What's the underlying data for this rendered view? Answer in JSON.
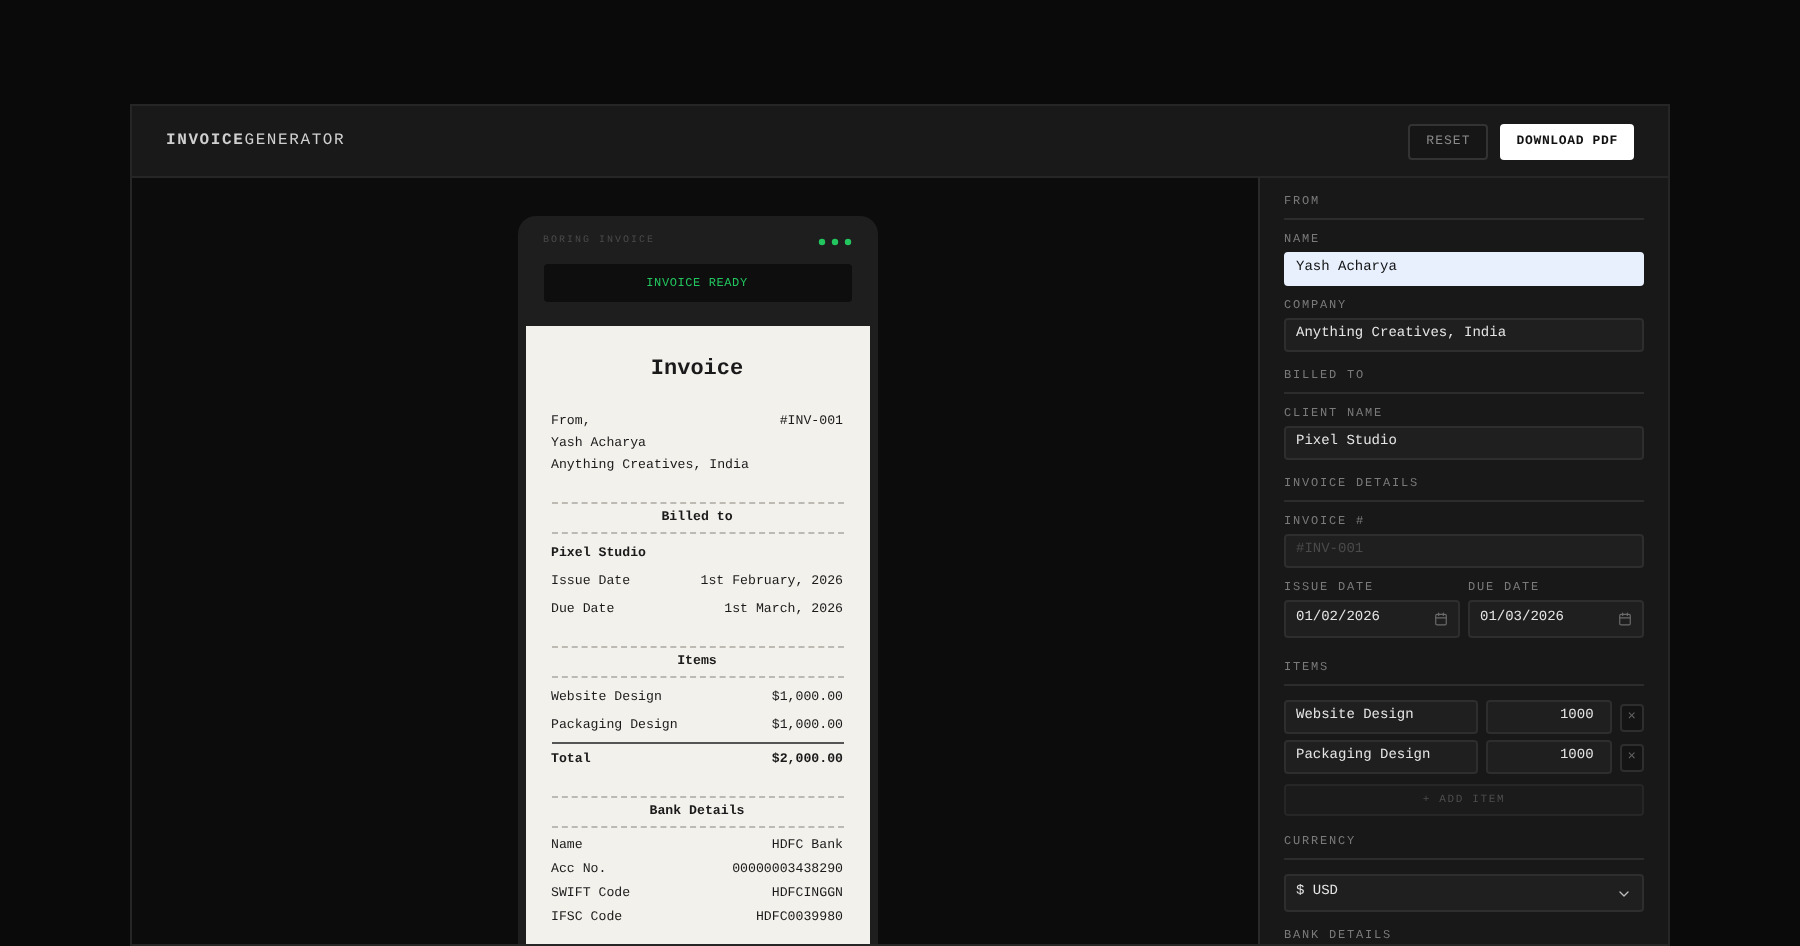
{
  "header": {
    "title": "**INVOICE**GENERATOR",
    "buttons": [
      {
        "label": "RESET",
        "kind": "secondary"
      },
      {
        "label": "DOWNLOAD PDF",
        "kind": "primary"
      }
    ]
  },
  "device": {
    "label": "BORING INVOICE",
    "status": "INVOICE READY"
  },
  "receipt": {
    "title": "Invoice",
    "from_label": "From,",
    "number": "#INV-001",
    "from_name": "Yash Acharya",
    "from_company": "Anything Creatives, India",
    "billed_heading": "Billed to",
    "client": "Pixel Studio",
    "dates": [
      {
        "label": "Issue Date",
        "value": "1st February, 2026"
      },
      {
        "label": "Due Date",
        "value": "1st March, 2026"
      }
    ],
    "items_heading": "Items",
    "items": [
      {
        "name": "Website Design",
        "amount": "$1,000.00"
      },
      {
        "name": "Packaging Design",
        "amount": "$1,000.00"
      }
    ],
    "total": {
      "label": "Total",
      "value": "$2,000.00"
    },
    "bank_heading": "Bank Details",
    "bank": [
      {
        "label": "Name",
        "value": "HDFC Bank"
      },
      {
        "label": "Acc No.",
        "value": "00000003438290"
      },
      {
        "label": "SWIFT Code",
        "value": "HDFCINGGN"
      },
      {
        "label": "IFSC Code",
        "value": "HDFC0039980"
      }
    ]
  },
  "form": {
    "sections": [
      {
        "title": "FROM",
        "fields": [
          {
            "label": "NAME",
            "value": "Yash Acharya",
            "autofilled": true
          },
          {
            "label": "COMPANY",
            "value": "Anything Creatives, India",
            "autofilled": false
          }
        ]
      },
      {
        "title": "BILLED TO",
        "fields": [
          {
            "label": "CLIENT NAME",
            "value": "Pixel Studio",
            "autofilled": false
          }
        ]
      },
      {
        "title": "INVOICE DETAILS",
        "fields": [
          {
            "label": "INVOICE #",
            "placeholder": "#INV-001",
            "autofilled": false
          }
        ],
        "dates": [
          {
            "label": "ISSUE DATE",
            "value": "01/02/2026"
          },
          {
            "label": "DUE DATE",
            "value": "01/03/2026"
          }
        ]
      }
    ],
    "items_title": "ITEMS",
    "items": [
      {
        "name": "Website Design",
        "amount": "1000",
        "remove": "×"
      },
      {
        "name": "Packaging Design",
        "amount": "1000",
        "remove": "×"
      }
    ],
    "add_item": "+ ADD ITEM",
    "currency_title": "CURRENCY",
    "currency": "$ USD",
    "bank_title": "BANK DETAILS"
  }
}
